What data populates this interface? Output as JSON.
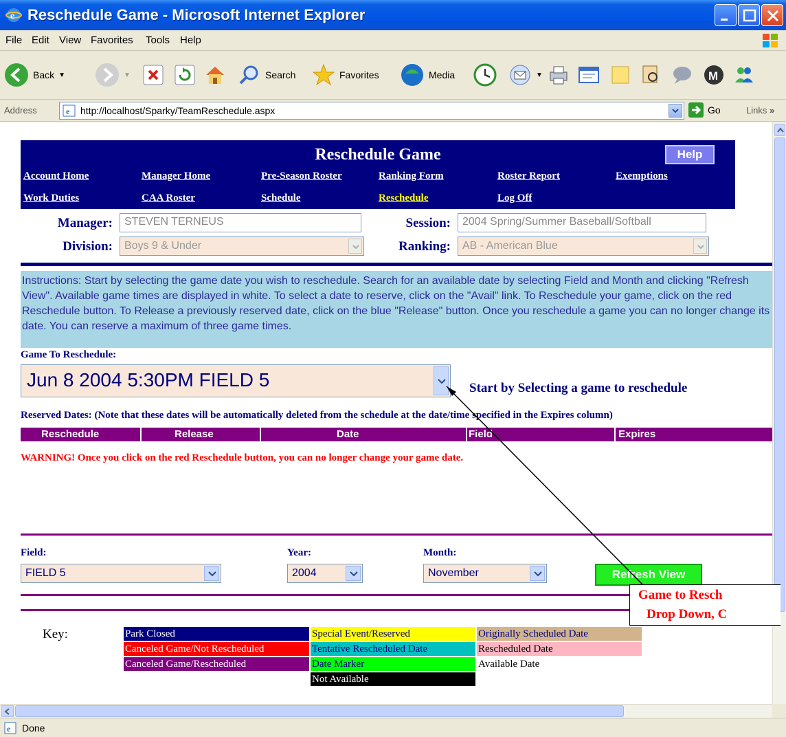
{
  "window": {
    "title": "Reschedule Game - Microsoft Internet Explorer"
  },
  "menu": [
    "File",
    "Edit",
    "View",
    "Favorites",
    "Tools",
    "Help"
  ],
  "toolbar": {
    "back": "Back",
    "search": "Search",
    "favorites": "Favorites",
    "media": "Media"
  },
  "address": {
    "label": "Address",
    "url": "http://localhost/Sparky/TeamReschedule.aspx",
    "go": "Go",
    "links": "Links"
  },
  "status": {
    "text": "Done"
  },
  "page": {
    "title": "Reschedule Game",
    "help": "Help",
    "nav": [
      {
        "label": "Account Home"
      },
      {
        "label": "Manager Home"
      },
      {
        "label": "Pre-Season Roster"
      },
      {
        "label": "Ranking Form"
      },
      {
        "label": "Roster Report"
      },
      {
        "label": "Exemptions"
      },
      {
        "label": "Work Duties"
      },
      {
        "label": "CAA Roster"
      },
      {
        "label": "Schedule"
      },
      {
        "label": "Reschedule"
      },
      {
        "label": "Log Off"
      }
    ],
    "manager_label": "Manager:",
    "manager_value": "STEVEN TERNEUS",
    "session_label": "Session:",
    "session_value": "2004 Spring/Summer Baseball/Softball",
    "division_label": "Division:",
    "division_value": "Boys 9 & Under",
    "ranking_label": "Ranking:",
    "ranking_value": "AB - American Blue",
    "instructions": "Instructions: Start by selecting the game date you wish to reschedule. Search for an available date by selecting Field and Month and clicking \"Refresh View\". Available game times are displayed in white. To select a date to reserve, click on the \"Avail\" link. To Reschedule your game, click on the red Reschedule button. To Release a previously reserved date, click on the blue \"Release\" button. Once you reschedule a game you can no longer change its date. You can reserve a maximum of three game times.",
    "game_label": "Game To Reschedule:",
    "game_value": "Jun 8 2004 5:30PM FIELD 5",
    "game_hint": "Start by Selecting a game to reschedule",
    "reserved_label": "Reserved Dates: (Note that these dates will be automatically deleted from the schedule at the date/time specified in the Expires column)",
    "columns": [
      "Reschedule",
      "Release",
      "Date",
      "Field",
      "Expires"
    ],
    "warning": "WARNING! Once you click on the red Reschedule button, you can no longer change your game date.",
    "field_label": "Field:",
    "field_value": "FIELD 5",
    "year_label": "Year:",
    "year_value": "2004",
    "month_label": "Month:",
    "month_value": "November",
    "refresh": "Refresh View",
    "key_label": "Key:",
    "key": [
      {
        "label": "Park Closed",
        "bg": "#000080",
        "fg": "#ffffff"
      },
      {
        "label": "Special Event/Reserved",
        "bg": "#ffff00",
        "fg": "#000080"
      },
      {
        "label": "Originally Scheduled Date",
        "bg": "#d2b48c",
        "fg": "#000080"
      },
      {
        "label": "Canceled Game/Not Rescheduled",
        "bg": "#ff0000",
        "fg": "#ffffff"
      },
      {
        "label": "Tentative Rescheduled Date",
        "bg": "#00c0c0",
        "fg": "#000080"
      },
      {
        "label": "Rescheduled Date",
        "bg": "#ffb6c1",
        "fg": "#000000"
      },
      {
        "label": "Canceled Game/Rescheduled",
        "bg": "#800080",
        "fg": "#ffffff"
      },
      {
        "label": "Date Marker",
        "bg": "#00ff00",
        "fg": "#000080"
      },
      {
        "label": "Available Date",
        "bg": "#ffffff",
        "fg": "#000000"
      },
      {
        "label": "Not Available",
        "bg": "#000000",
        "fg": "#ffffff"
      }
    ],
    "annotation_line1": "Game to Resch",
    "annotation_line2": "Drop Down,   C"
  }
}
